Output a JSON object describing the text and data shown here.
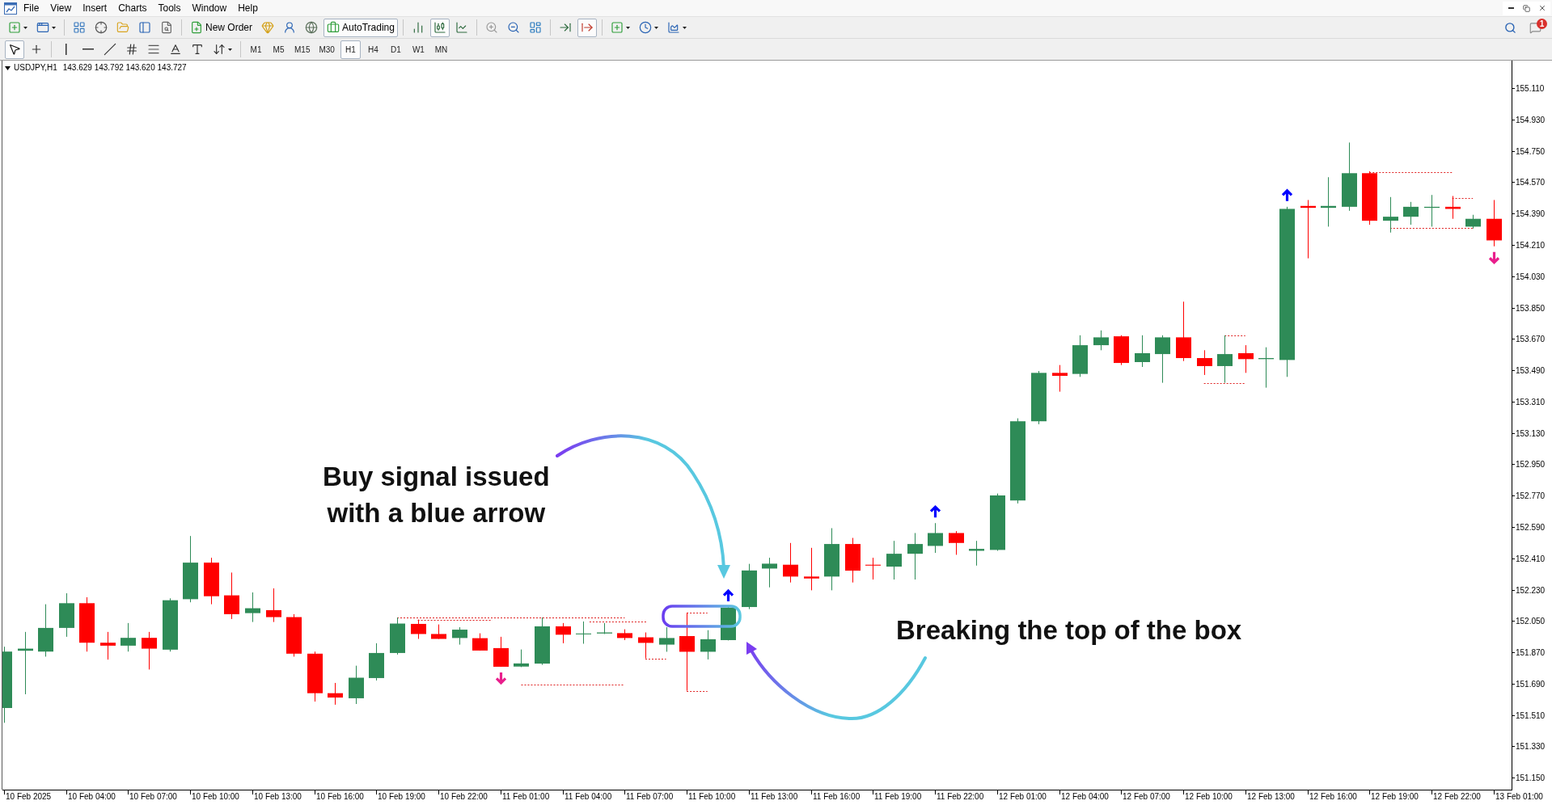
{
  "menu_bar": {
    "items": [
      "File",
      "View",
      "Insert",
      "Charts",
      "Tools",
      "Window",
      "Help"
    ]
  },
  "standard_toolbar": {
    "new_order": {
      "label": "New Order"
    },
    "auto_trading": {
      "label": "AutoTrading",
      "on": true
    },
    "chart_types": [
      {
        "selected": false
      },
      {
        "selected": true
      },
      {
        "selected": false
      }
    ],
    "auto_scroll": {
      "on": true
    }
  },
  "notifications": {
    "count": "1"
  },
  "line_studies": {
    "tools": [
      {
        "selected": true
      },
      {
        "selected": false
      }
    ]
  },
  "periods": [
    {
      "label": "M1",
      "selected": false
    },
    {
      "label": "M5",
      "selected": false
    },
    {
      "label": "M15",
      "selected": false
    },
    {
      "label": "M30",
      "selected": false
    },
    {
      "label": "H1",
      "selected": true
    },
    {
      "label": "H4",
      "selected": false
    },
    {
      "label": "D1",
      "selected": false
    },
    {
      "label": "W1",
      "selected": false
    },
    {
      "label": "MN",
      "selected": false
    }
  ],
  "chart": {
    "symbol": "USDJPY,H1",
    "quote": "143.629 143.792 143.620 143.727",
    "price_axis": [
      "155.110",
      "154.930",
      "154.750",
      "154.570",
      "154.390",
      "154.210",
      "154.030",
      "153.850",
      "153.670",
      "153.490",
      "153.310",
      "153.130",
      "152.950",
      "152.770",
      "152.590",
      "152.410",
      "152.230",
      "152.050",
      "151.870",
      "151.690",
      "151.510",
      "151.330",
      "151.150"
    ],
    "time_axis": [
      "10 Feb 2025",
      "10 Feb 04:00",
      "10 Feb 07:00",
      "10 Feb 10:00",
      "10 Feb 13:00",
      "10 Feb 16:00",
      "10 Feb 19:00",
      "10 Feb 22:00",
      "11 Feb 01:00",
      "11 Feb 04:00",
      "11 Feb 07:00",
      "11 Feb 10:00",
      "11 Feb 13:00",
      "11 Feb 16:00",
      "11 Feb 19:00",
      "11 Feb 22:00",
      "12 Feb 01:00",
      "12 Feb 04:00",
      "12 Feb 07:00",
      "12 Feb 10:00",
      "12 Feb 13:00",
      "12 Feb 16:00",
      "12 Feb 19:00",
      "12 Feb 22:00",
      "13 Feb 01:00"
    ],
    "signals": [
      {
        "kind": "sell",
        "color": "#e91e8c"
      },
      {
        "kind": "buy",
        "color": "#0000ff"
      },
      {
        "kind": "buy",
        "color": "#0000ff"
      },
      {
        "kind": "buy",
        "color": "#0000ff"
      },
      {
        "kind": "sell",
        "color": "#e91e8c"
      }
    ],
    "callouts": [
      {
        "text": "Buy signal issued\nwith a blue arrow"
      },
      {
        "text": "Breaking the top of the box"
      }
    ]
  }
}
